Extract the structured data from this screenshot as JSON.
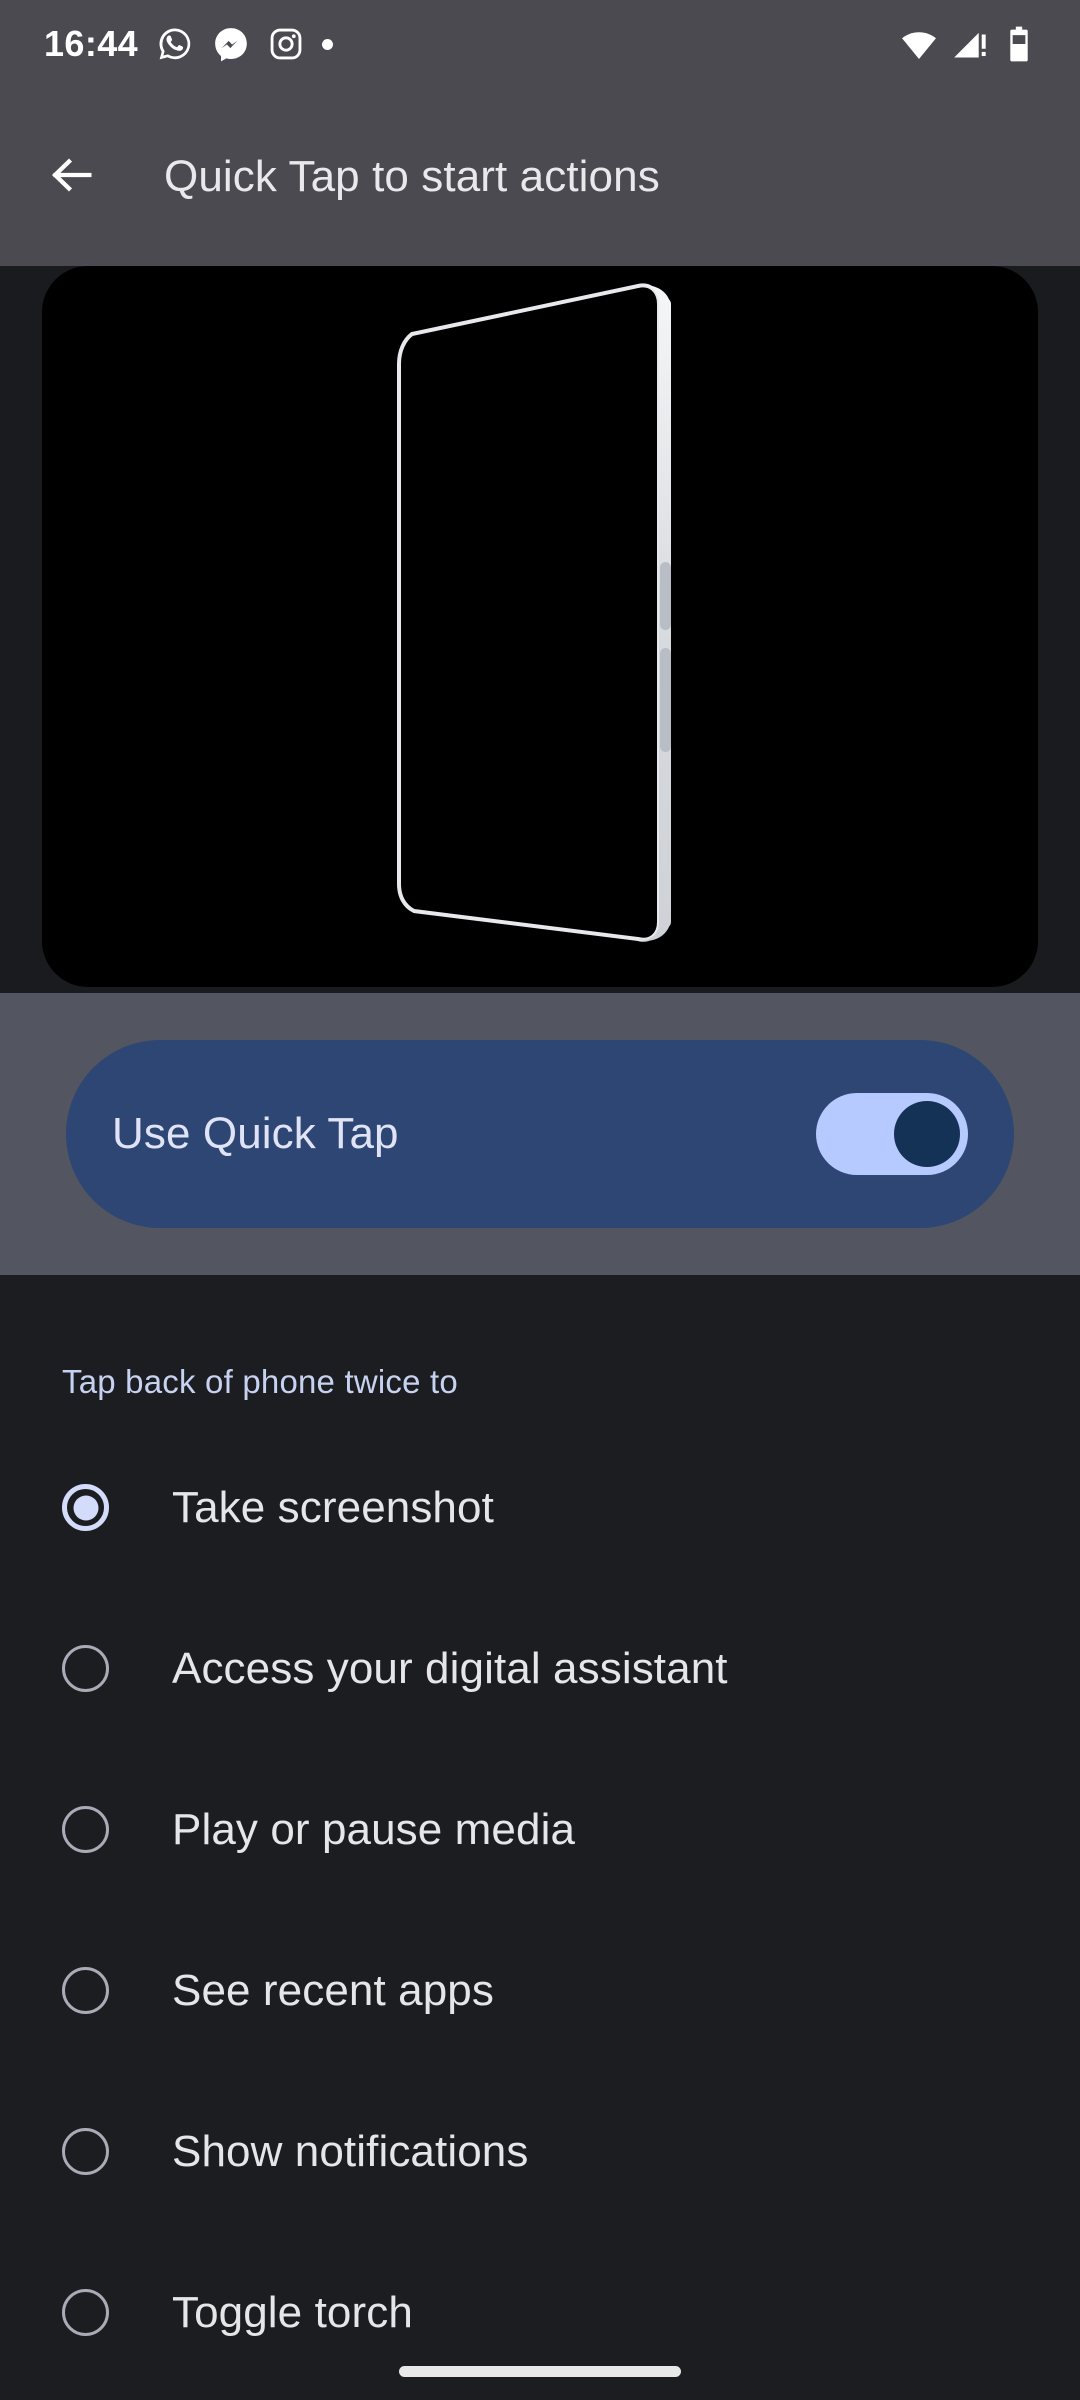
{
  "status_bar": {
    "clock": "16:44",
    "notification_icons": [
      "whatsapp-icon",
      "messenger-icon",
      "instagram-icon",
      "notification-dot-icon"
    ],
    "system_icons": [
      "wifi-icon",
      "cellular-signal-alert-icon",
      "battery-icon"
    ]
  },
  "app_bar": {
    "back_icon": "back-arrow-icon",
    "title": "Quick Tap to start actions"
  },
  "illustration": {
    "name": "quick-tap-phone-animation",
    "background_color": "#000000"
  },
  "toggle_card": {
    "label": "Use Quick Tap",
    "enabled": true,
    "card_color": "#2d4673",
    "track_color": "#b7caff",
    "thumb_color": "#143156",
    "band_color": "#535661"
  },
  "list": {
    "header": "Tap back of phone twice to",
    "header_color": "#c7d2f0",
    "selected_index": 0,
    "options": [
      {
        "label": "Take screenshot",
        "selected": true
      },
      {
        "label": "Access your digital assistant",
        "selected": false
      },
      {
        "label": "Play or pause media",
        "selected": false
      },
      {
        "label": "See recent apps",
        "selected": false
      },
      {
        "label": "Show notifications",
        "selected": false
      },
      {
        "label": "Toggle torch",
        "selected": false
      }
    ]
  },
  "nav_bar": {
    "handle": "home-gesture-handle"
  }
}
